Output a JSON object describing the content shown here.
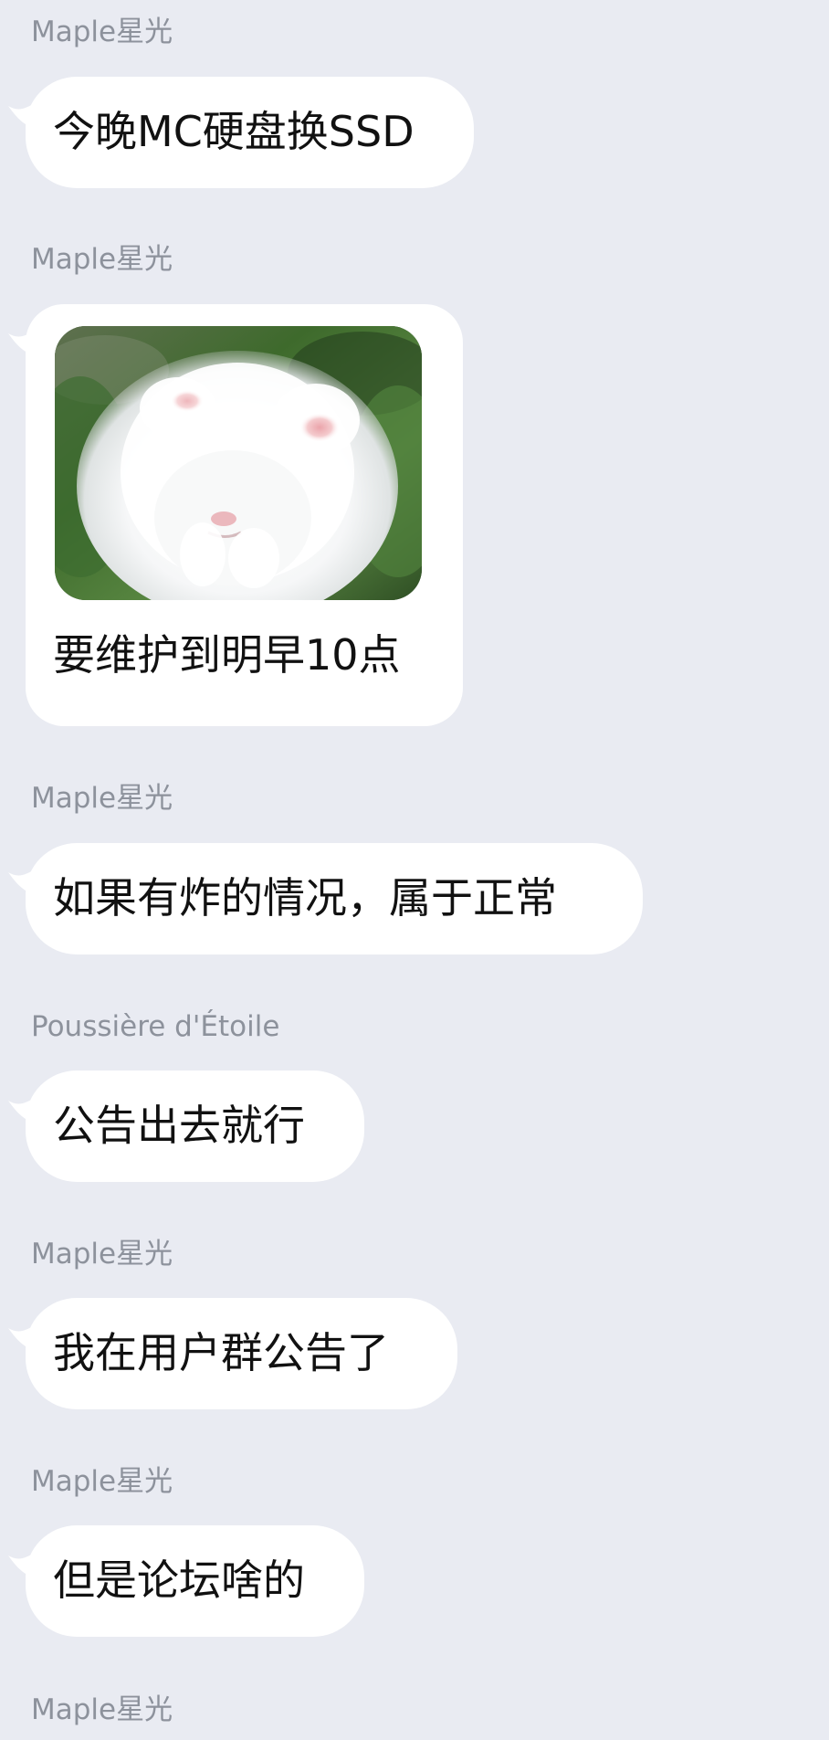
{
  "chat": {
    "messages": [
      {
        "sender": "Maple星光",
        "text": "今晚MC硬盘换SSD",
        "type": "text"
      },
      {
        "sender": "Maple星光",
        "image": "fluffy-white-rabbit-sticker",
        "caption": "要维护到明早10点",
        "type": "image-with-caption"
      },
      {
        "sender": "Maple星光",
        "text": "如果有炸的情况，属于正常",
        "type": "text"
      },
      {
        "sender": "Poussière d'Étoile",
        "text": "公告出去就行",
        "type": "text"
      },
      {
        "sender": "Maple星光",
        "text": "我在用户群公告了",
        "type": "text"
      },
      {
        "sender": "Maple星光",
        "text": "但是论坛啥的",
        "type": "text"
      },
      {
        "sender": "Maple星光",
        "type": "sender-only"
      }
    ]
  },
  "colors": {
    "background": "#e9ebf2",
    "bubble": "#ffffff",
    "sender_text": "#8d929c",
    "message_text": "#111111"
  }
}
